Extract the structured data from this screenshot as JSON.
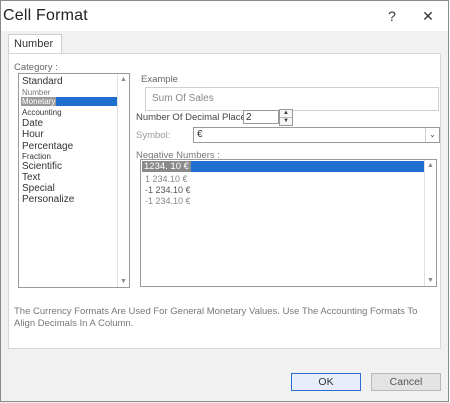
{
  "window": {
    "title": "Cell Format",
    "help_label": "?",
    "close_label": "✕"
  },
  "tabs": [
    {
      "label": "Number"
    }
  ],
  "category": {
    "label": "Category :",
    "items": [
      {
        "label": "Standard",
        "selected": false
      },
      {
        "label": "Number",
        "selected": false
      },
      {
        "label": "Monetary",
        "selected": true
      },
      {
        "label": "Accounting",
        "selected": false
      },
      {
        "label": "Date",
        "selected": false
      },
      {
        "label": "Hour",
        "selected": false
      },
      {
        "label": "Percentage",
        "selected": false
      },
      {
        "label": "Fraction",
        "selected": false
      },
      {
        "label": "Scientific",
        "selected": false
      },
      {
        "label": "Text",
        "selected": false
      },
      {
        "label": "Special",
        "selected": false
      },
      {
        "label": "Personalize",
        "selected": false
      }
    ]
  },
  "example": {
    "label": "Example",
    "value": "Sum Of Sales"
  },
  "decimal_places": {
    "label": "Number Of Decimal Places:",
    "value": "2"
  },
  "symbol": {
    "label": "Symbol:",
    "value": "€"
  },
  "negative_numbers": {
    "label": "Negative Numbers :",
    "items": [
      {
        "label": "1234. 10 €",
        "selected": true
      },
      {
        "label": "1 234.10 €",
        "selected": false
      },
      {
        "label": "-1 234.10 €",
        "selected": false
      },
      {
        "label": "-1 234.10 €",
        "selected": false
      }
    ]
  },
  "description": "The Currency Formats Are Used For General Monetary Values. Use The Accounting Formats To Align Decimals In A Column.",
  "buttons": {
    "ok": "OK",
    "cancel": "Cancel"
  }
}
